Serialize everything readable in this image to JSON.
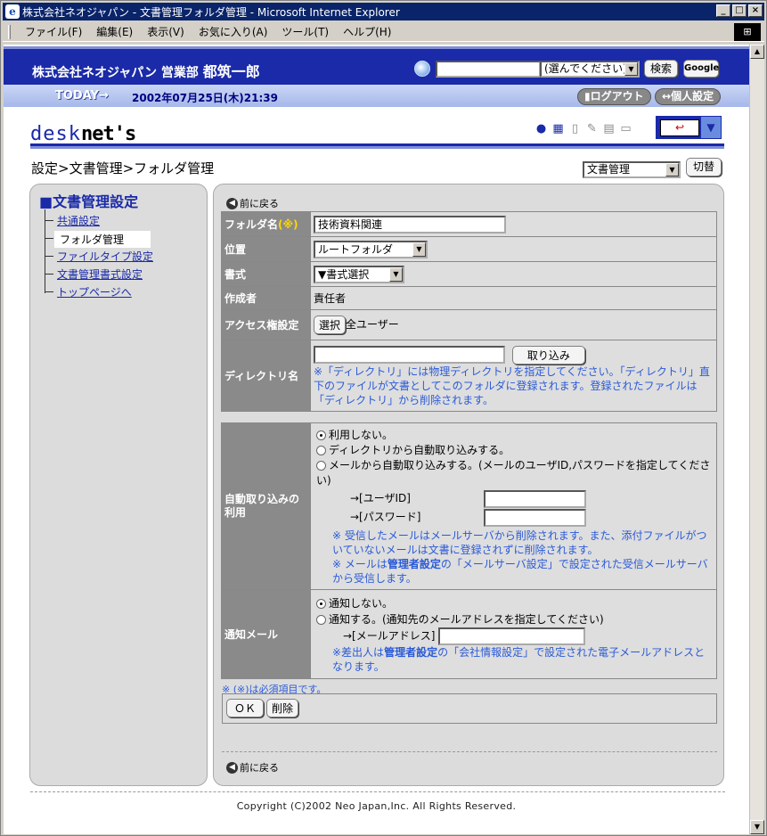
{
  "window": {
    "title": "株式会社ネオジャパン - 文書管理フォルダ管理 - Microsoft Internet Explorer",
    "controls": [
      "_",
      "□",
      "×"
    ]
  },
  "menu": [
    "ファイル(F)",
    "編集(E)",
    "表示(V)",
    "お気に入り(A)",
    "ツール(T)",
    "ヘルプ(H)"
  ],
  "header": {
    "company": "株式会社ネオジャパン 営業部",
    "user": "都筑一郎",
    "search_select": "(選んでください)",
    "search_button": "検索",
    "google_button": "Google"
  },
  "todaybar": {
    "today": "TODAY",
    "datetime": "2002年07月25日(木)21:39",
    "logout": "ログアウト",
    "personal": "個人設定"
  },
  "logo": {
    "lite": "desk",
    "heavy": "net's"
  },
  "breadcrumb": "設定>文書管理>フォルダ管理",
  "module_select": "文書管理",
  "switch_button": "切替",
  "sidebar": {
    "title": "■文書管理設定",
    "items": [
      {
        "label": "共通設定"
      },
      {
        "label": "フォルダ管理"
      },
      {
        "label": "ファイルタイプ設定"
      },
      {
        "label": "文書管理書式設定"
      },
      {
        "label": "トップページへ"
      }
    ]
  },
  "back_label": "前に戻る",
  "form": {
    "folder_name_label": "フォルダ名",
    "required_mark": "(※)",
    "folder_name_value": "技術資料関連",
    "position_label": "位置",
    "position_value": "ルートフォルダ",
    "format_label": "書式",
    "format_value": "▼書式選択",
    "creator_label": "作成者",
    "creator_value": "責任者",
    "access_label": "アクセス権設定",
    "access_button": "選択",
    "access_value": "全ユーザー",
    "dir_label": "ディレクトリ名",
    "dir_button": "取り込み",
    "dir_note": "※「ディレクトリ」には物理ディレクトリを指定してください。「ディレクトリ」直下のファイルが文書としてこのフォルダに登録されます。登録されたファイルは「ディレクトリ」から削除されます。"
  },
  "auto": {
    "label": "自動取り込みの利用",
    "opt1": "利用しない。",
    "opt2": "ディレクトリから自動取り込みする。",
    "opt3": "メールから自動取り込みする。(メールのユーザID,パスワードを指定してください)",
    "user_id_label": "→[ユーザID]",
    "password_label": "→[パスワード]",
    "note1": "※ 受信したメールはメールサーバから削除されます。また、添付ファイルがついていないメールは文書に登録されずに削除されます。",
    "note2_pre": "※ メールは",
    "note2_admin": "管理者設定",
    "note2_post": "の「メールサーバ設定」で設定された受信メールサーバから受信します。"
  },
  "notify": {
    "label": "通知メール",
    "opt1": "通知しない。",
    "opt2": "通知する。(通知先のメールアドレスを指定してください)",
    "email_label": "→[メールアドレス]",
    "note_pre": "※差出人は",
    "note_admin": "管理者設定",
    "note_post": "の「会社情報設定」で設定された電子メールアドレスとなります。"
  },
  "required_note": "※ (※)は必須項目です。",
  "buttons": {
    "ok": "ＯＫ",
    "delete": "削除"
  },
  "footer": "Copyright (C)2002 Neo Japan,Inc. All Rights Reserved.",
  "colors": {
    "header_blue": "#1a2aa8",
    "note_blue": "#2a5ad8",
    "label_gray": "#8a8a8a"
  }
}
